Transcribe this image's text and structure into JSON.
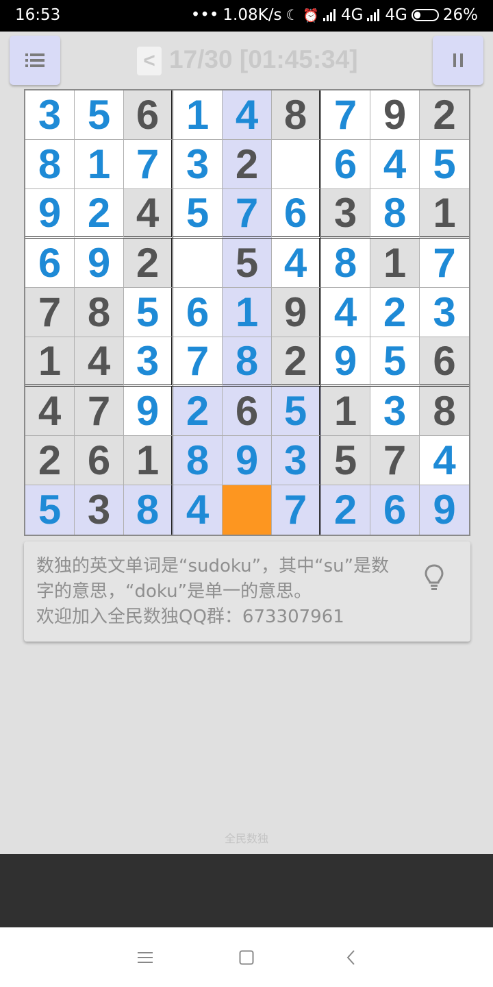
{
  "status_bar": {
    "time": "16:53",
    "dots": "•••",
    "speed": "1.08K/s",
    "moon_icon": "☾",
    "alarm_icon": "⏰",
    "net1": "4G",
    "net2": "4G",
    "battery": "26%"
  },
  "toolbar": {
    "prev_label": "<",
    "progress": "17/30 [01:45:34]"
  },
  "colors": {
    "given": "#545454",
    "user": "#1e8ad6",
    "gray_cell": "#e0e0e0",
    "white_cell": "#ffffff",
    "highlight_cell": "#dadcf6",
    "selected_cell": "#fd9620"
  },
  "board": {
    "rows": [
      [
        "3",
        "5",
        "6",
        "1",
        "4",
        "8",
        "7",
        "9",
        "2"
      ],
      [
        "8",
        "1",
        "7",
        "3",
        "2",
        "",
        "6",
        "4",
        "5"
      ],
      [
        "9",
        "2",
        "4",
        "5",
        "7",
        "6",
        "3",
        "8",
        "1"
      ],
      [
        "6",
        "9",
        "2",
        "",
        "5",
        "4",
        "8",
        "1",
        "7"
      ],
      [
        "7",
        "8",
        "5",
        "6",
        "1",
        "9",
        "4",
        "2",
        "3"
      ],
      [
        "1",
        "4",
        "3",
        "7",
        "8",
        "2",
        "9",
        "5",
        "6"
      ],
      [
        "4",
        "7",
        "9",
        "2",
        "6",
        "5",
        "1",
        "3",
        "8"
      ],
      [
        "2",
        "6",
        "1",
        "8",
        "9",
        "3",
        "5",
        "7",
        "4"
      ],
      [
        "5",
        "3",
        "8",
        "4",
        "",
        "7",
        "2",
        "6",
        "9"
      ]
    ],
    "kinds": [
      [
        "u",
        "u",
        "g",
        "u",
        "u",
        "g",
        "u",
        "g",
        "g"
      ],
      [
        "u",
        "u",
        "u",
        "u",
        "g",
        "u",
        "u",
        "u",
        "u"
      ],
      [
        "u",
        "u",
        "g",
        "u",
        "u",
        "u",
        "g",
        "u",
        "g"
      ],
      [
        "u",
        "u",
        "g",
        "u",
        "g",
        "u",
        "u",
        "g",
        "u"
      ],
      [
        "g",
        "g",
        "u",
        "u",
        "u",
        "g",
        "u",
        "u",
        "u"
      ],
      [
        "g",
        "g",
        "u",
        "u",
        "u",
        "g",
        "u",
        "u",
        "g"
      ],
      [
        "g",
        "g",
        "u",
        "u",
        "g",
        "u",
        "g",
        "u",
        "g"
      ],
      [
        "g",
        "g",
        "g",
        "u",
        "u",
        "u",
        "g",
        "g",
        "u"
      ],
      [
        "u",
        "g",
        "u",
        "u",
        "u",
        "u",
        "u",
        "u",
        "u"
      ]
    ],
    "backgrounds": [
      [
        "w",
        "w",
        "x",
        "w",
        "h",
        "x",
        "w",
        "w",
        "x"
      ],
      [
        "w",
        "w",
        "w",
        "w",
        "h",
        "w",
        "w",
        "w",
        "w"
      ],
      [
        "w",
        "w",
        "x",
        "w",
        "h",
        "w",
        "x",
        "w",
        "x"
      ],
      [
        "w",
        "w",
        "x",
        "w",
        "h",
        "w",
        "w",
        "x",
        "w"
      ],
      [
        "x",
        "x",
        "w",
        "w",
        "h",
        "x",
        "w",
        "w",
        "w"
      ],
      [
        "x",
        "x",
        "w",
        "w",
        "h",
        "x",
        "w",
        "w",
        "x"
      ],
      [
        "x",
        "x",
        "w",
        "h",
        "h",
        "h",
        "x",
        "w",
        "x"
      ],
      [
        "x",
        "x",
        "x",
        "h",
        "h",
        "h",
        "x",
        "x",
        "w"
      ],
      [
        "h",
        "h",
        "h",
        "h",
        "s",
        "h",
        "h",
        "h",
        "h"
      ]
    ]
  },
  "hint": {
    "line1": "数独的英文单词是“sudoku”，其中“su”是数",
    "line2": "字的意思，“doku”是单一的意思。",
    "line3": "欢迎加入全民数独QQ群：673307961"
  },
  "footer": {
    "label": "全民数独"
  }
}
